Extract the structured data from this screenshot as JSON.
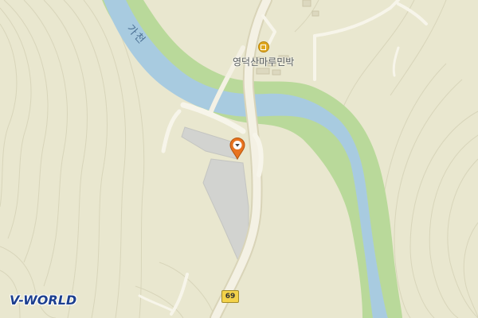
{
  "map": {
    "river_label": "가천",
    "poi": {
      "name": "영덕산마루민박",
      "icon": "lodging-icon",
      "color": "#e0a820"
    },
    "marker": {
      "icon": "location-pin-icon",
      "color": "#e8731f"
    },
    "route_shield": "69",
    "logo": "V-WORLD",
    "colors": {
      "land": "#e9e7cf",
      "water": "#a8cbe0",
      "riverbank": "#b9d99a",
      "road": "#f4f1e4",
      "parking": "#d2d3d0"
    }
  }
}
